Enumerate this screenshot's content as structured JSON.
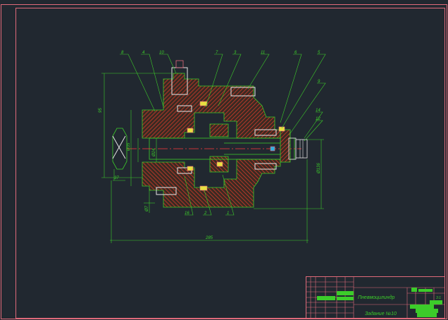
{
  "colors": {
    "background": "#212830",
    "frame": "#e06a7a",
    "hatch": "#d23a2a",
    "outline": "#3ccc2a",
    "white": "#e6e6e6",
    "centerline": "#ff3a3a",
    "yellow": "#e8e040",
    "cyan": "#30b0e0"
  },
  "drawing": {
    "callouts": [
      "8",
      "4",
      "10",
      "7",
      "3",
      "11",
      "6",
      "5",
      "9",
      "14",
      "12",
      "16",
      "2",
      "1"
    ],
    "dimensions": {
      "left_height": "95",
      "bore_a": "Ø35",
      "bore_b": "Ø24",
      "small_width": "37",
      "right_height": "Ø136",
      "overall_length": "285",
      "vertical_small": "Ø7"
    }
  },
  "title_block": {
    "name": "Пневмоцилиндр",
    "assignment": "Задание №10",
    "scale": "3:1"
  }
}
